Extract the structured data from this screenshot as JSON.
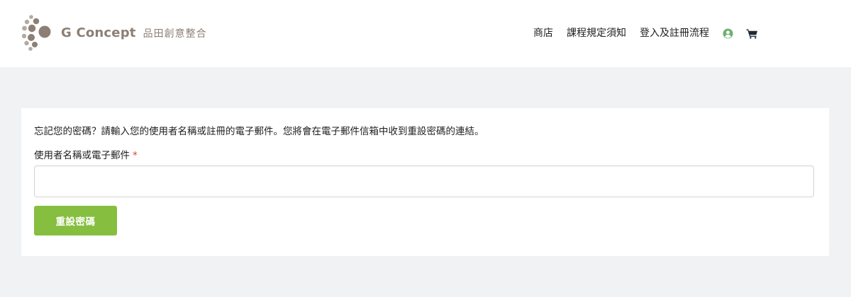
{
  "header": {
    "brand": "G Concept",
    "brand_sub": "品田創意整合",
    "nav": [
      {
        "label": "商店"
      },
      {
        "label": "課程規定須知"
      },
      {
        "label": "登入及註冊流程"
      }
    ],
    "icons": {
      "account": "user-circle-icon",
      "cart": "shopping-cart-icon"
    },
    "colors": {
      "account_icon": "#6fb06f",
      "cart_icon": "#1e2a35"
    }
  },
  "form": {
    "intro": "忘記您的密碼？請輸入您的使用者名稱或註冊的電子郵件。您將會在電子郵件信箱中收到重設密碼的連結。",
    "label": "使用者名稱或電子郵件",
    "required_mark": "*",
    "input_value": "",
    "submit_label": "重設密碼",
    "accent": "#86be3f"
  }
}
